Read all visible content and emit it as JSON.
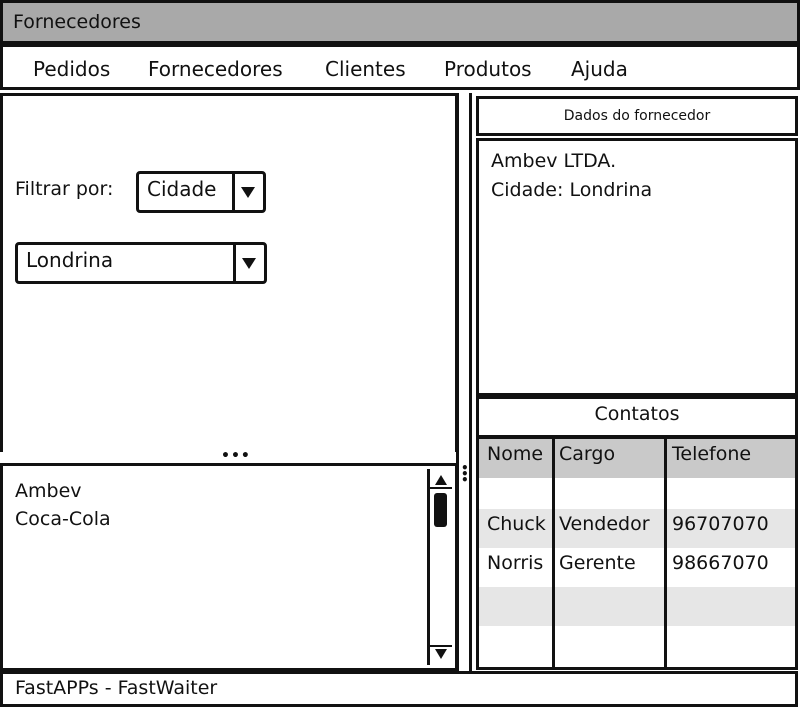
{
  "window": {
    "title": "Fornecedores"
  },
  "menu": [
    "Pedidos",
    "Fornecedores",
    "Clientes",
    "Produtos",
    "Ajuda"
  ],
  "filter": {
    "label": "Filtrar por:",
    "field_selected": "Cidade",
    "value_selected": "Londrina"
  },
  "list": {
    "items": [
      "Ambev",
      "Coca-Cola"
    ]
  },
  "details": {
    "header": "Dados do fornecedor",
    "lines": [
      "Ambev LTDA.",
      "Cidade: Londrina"
    ]
  },
  "contacts": {
    "header": "Contatos",
    "columns": [
      "Nome",
      "Cargo",
      "Telefone"
    ],
    "rows": [
      [
        "",
        "",
        ""
      ],
      [
        "Chuck",
        "Vendedor",
        "96707070"
      ],
      [
        "Norris",
        "Gerente",
        "98667070"
      ],
      [
        "",
        "",
        ""
      ],
      [
        "",
        "",
        ""
      ]
    ]
  },
  "status": {
    "text": "FastAPPs - FastWaiter"
  },
  "colors": {
    "titlebar": "#a9a9a9",
    "table_header": "#c9c9c9",
    "row_shade": "#e6e6e6"
  }
}
